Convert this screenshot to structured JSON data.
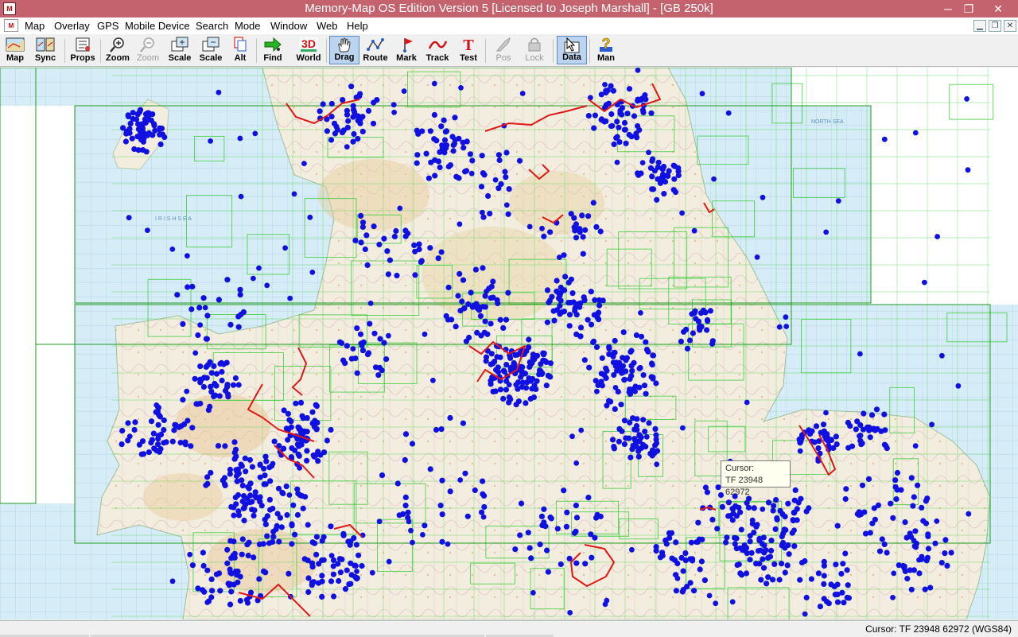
{
  "window": {
    "title": "Memory-Map OS Edition Version 5 [Licensed to Joseph Marshall] - [GB 250k]",
    "minimize": "─",
    "restore": "❐",
    "close": "✕"
  },
  "menu": [
    "Map",
    "Overlay",
    "GPS",
    "Mobile Device",
    "Search",
    "Mode",
    "Window",
    "Web",
    "Help"
  ],
  "toolbar": {
    "map": "Map",
    "sync": "Sync",
    "props": "Props",
    "zoom_in": "Zoom",
    "zoom_out": "Zoom",
    "scale_up": "Scale",
    "scale_down": "Scale",
    "alt": "Alt",
    "find": "Find",
    "world": "World",
    "world_badge": "3D",
    "drag": "Drag",
    "route": "Route",
    "mark": "Mark",
    "track": "Track",
    "test": "Test",
    "test_glyph": "T",
    "pos": "Pos",
    "lock": "Lock",
    "data": "Data",
    "man": "Man",
    "man_glyph": "?"
  },
  "map": {
    "sea_label_north": "NORTH SEA",
    "sea_label_irish": "I R I S H   S E A"
  },
  "tooltip": {
    "line1": "Cursor:",
    "line2": "TF 23948 62972"
  },
  "status": {
    "text": "Cursor: TF 23948 62972 (WGS84)"
  },
  "colors": {
    "titlebar": "#c4626e",
    "sea": "#d6ecf6",
    "land": "#f3eddf",
    "grid_green": "#2fd12f",
    "waypoint_blue": "#1010e0",
    "track_red": "#e01818"
  }
}
